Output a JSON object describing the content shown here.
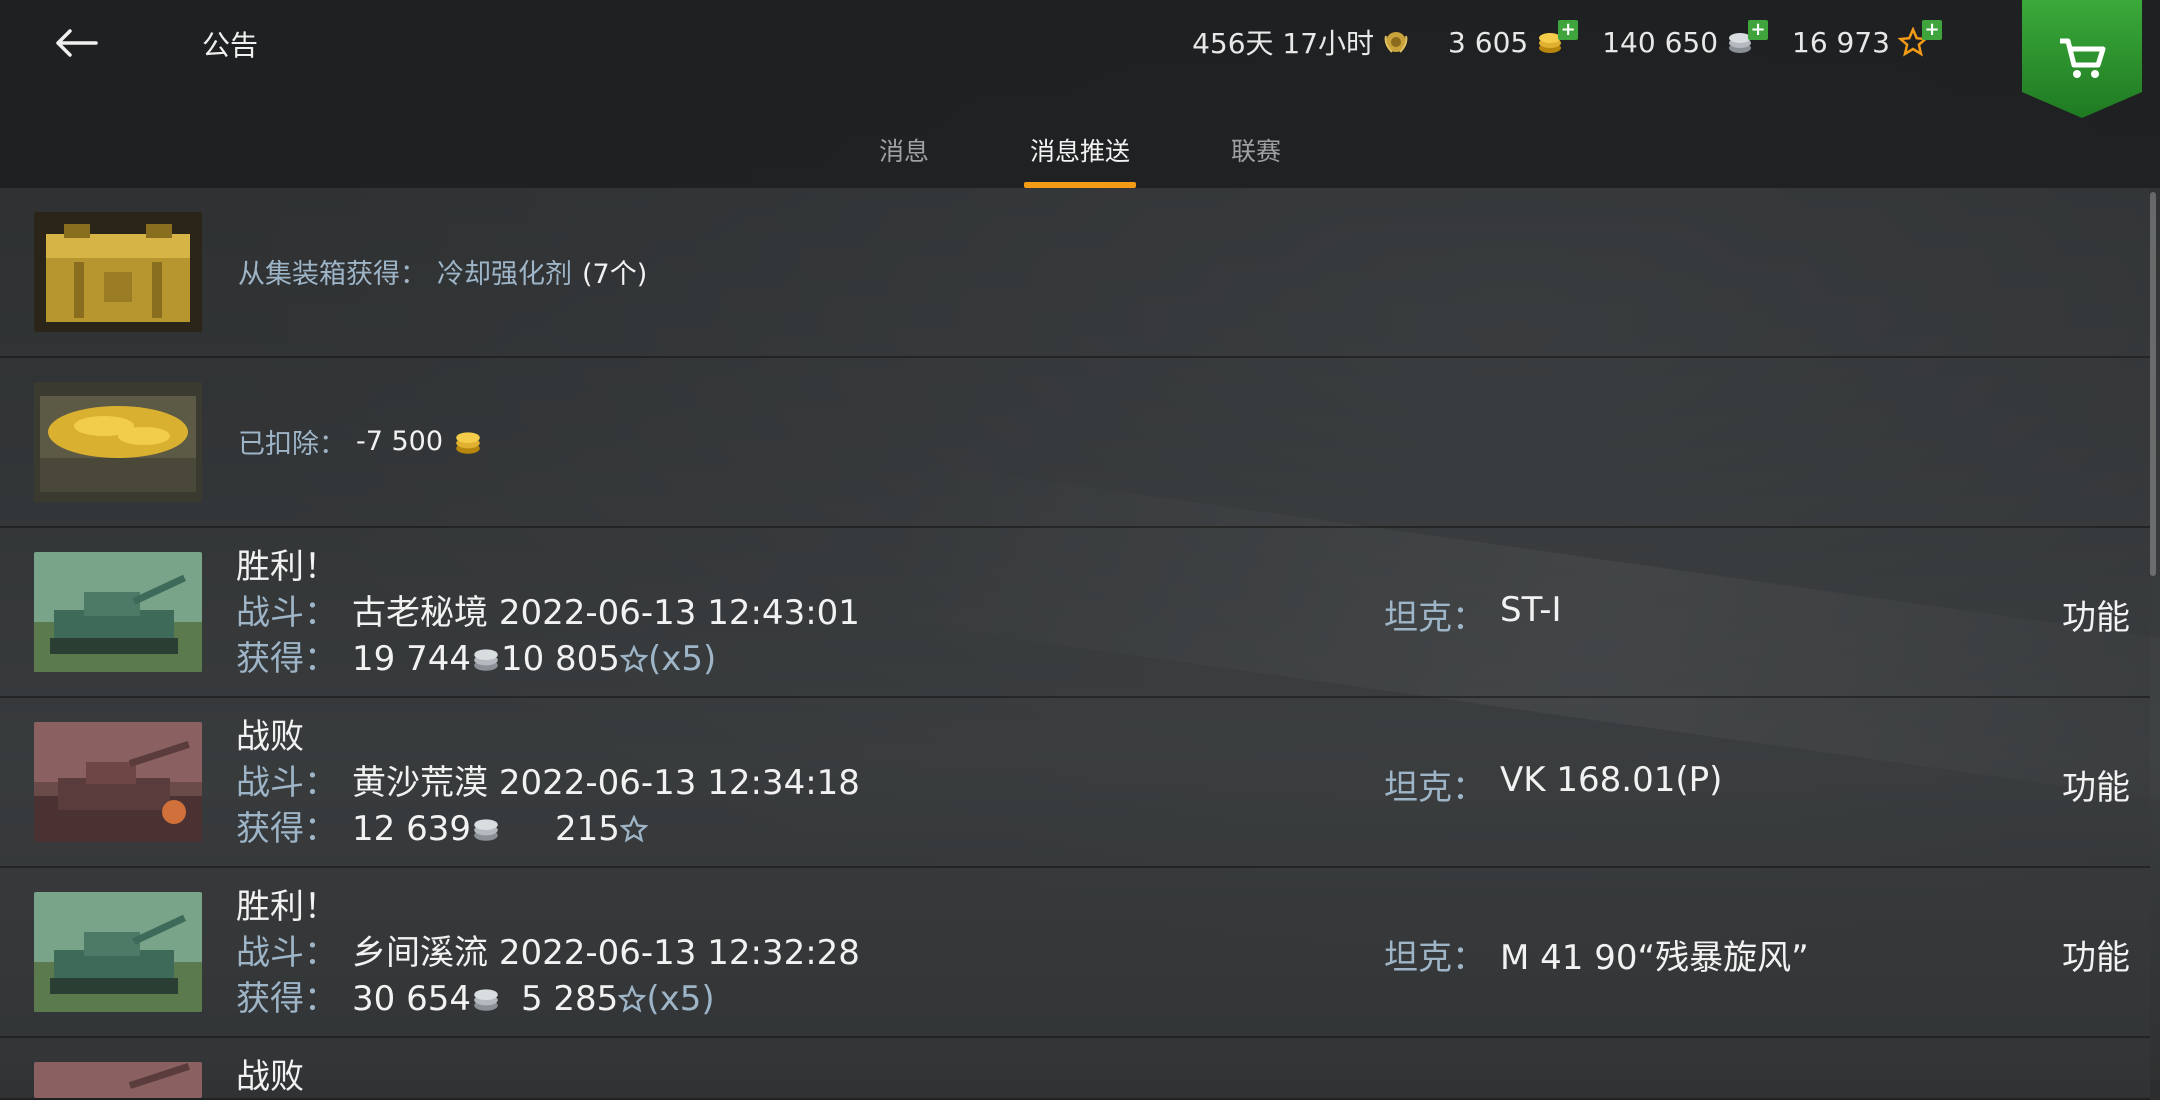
{
  "header": {
    "title": "公告",
    "premium_time": "456天 17小时",
    "gold": "3 605",
    "silver": "140 650",
    "free_xp": "16 973"
  },
  "tabs": [
    {
      "label": "消息"
    },
    {
      "label": "消息推送",
      "active": true
    },
    {
      "label": "联赛"
    }
  ],
  "rows": [
    {
      "type": "notice",
      "prefix": "从集装箱获得：",
      "item": "冷却强化剂",
      "count": "(7个)",
      "icon": "golden-container-icon"
    },
    {
      "type": "notice",
      "prefix": "已扣除：",
      "amount": "-7 500",
      "icon": "gold-chest-icon"
    },
    {
      "type": "battle",
      "result": "胜利！",
      "battle_label": "战斗：",
      "map": "古老秘境",
      "datetime": "2022-06-13 12:43:01",
      "earn_label": "获得：",
      "silver": "19 744",
      "xp": "10 805",
      "multiplier": "(x5)",
      "tank_label": "坦克：",
      "tank": "ST-I",
      "func": "功能"
    },
    {
      "type": "battle",
      "result": "战败",
      "battle_label": "战斗：",
      "map": "黄沙荒漠",
      "datetime": "2022-06-13 12:34:18",
      "earn_label": "获得：",
      "silver": "12 639",
      "xp": "215",
      "multiplier": "",
      "tank_label": "坦克：",
      "tank": "VK 168.01(P)",
      "func": "功能"
    },
    {
      "type": "battle",
      "result": "胜利！",
      "battle_label": "战斗：",
      "map": "乡间溪流",
      "datetime": "2022-06-13 12:32:28",
      "earn_label": "获得：",
      "silver": "30 654",
      "xp": "5 285",
      "multiplier": "(x5)",
      "tank_label": "坦克：",
      "tank": "M 41 90“残暴旋风”",
      "func": "功能"
    },
    {
      "type": "battle-partial",
      "result": "战败"
    }
  ],
  "colors": {
    "accent": "#f39b16",
    "label": "#9eb5c8",
    "shop": "#3ba93a"
  }
}
